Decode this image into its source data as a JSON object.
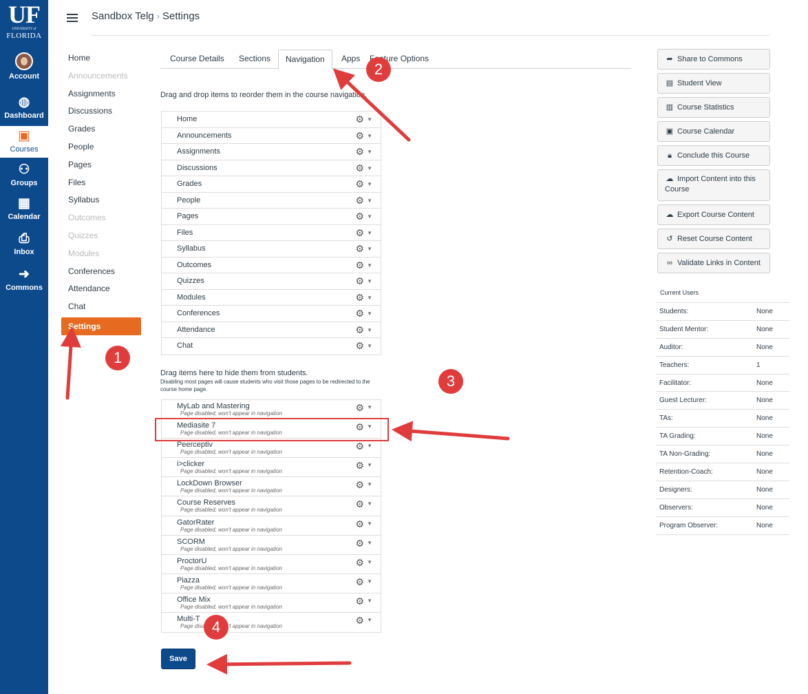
{
  "global_nav": {
    "logo": {
      "main": "UF",
      "university_of": "UNIVERSITY of",
      "florida": "FLORIDA"
    },
    "items": [
      {
        "label": "Account",
        "icon": "account-avatar"
      },
      {
        "label": "Dashboard",
        "icon": "dashboard-icon"
      },
      {
        "label": "Courses",
        "icon": "courses-icon"
      },
      {
        "label": "Groups",
        "icon": "groups-icon"
      },
      {
        "label": "Calendar",
        "icon": "calendar-icon"
      },
      {
        "label": "Inbox",
        "icon": "inbox-icon"
      },
      {
        "label": "Commons",
        "icon": "commons-icon"
      }
    ],
    "active": "Courses"
  },
  "breadcrumb": {
    "course": "Sandbox Telg",
    "page": "Settings"
  },
  "course_nav": [
    {
      "label": "Home",
      "state": "enabled"
    },
    {
      "label": "Announcements",
      "state": "disabled"
    },
    {
      "label": "Assignments",
      "state": "enabled"
    },
    {
      "label": "Discussions",
      "state": "enabled"
    },
    {
      "label": "Grades",
      "state": "enabled"
    },
    {
      "label": "People",
      "state": "enabled"
    },
    {
      "label": "Pages",
      "state": "enabled"
    },
    {
      "label": "Files",
      "state": "enabled"
    },
    {
      "label": "Syllabus",
      "state": "enabled"
    },
    {
      "label": "Outcomes",
      "state": "disabled"
    },
    {
      "label": "Quizzes",
      "state": "disabled"
    },
    {
      "label": "Modules",
      "state": "disabled"
    },
    {
      "label": "Conferences",
      "state": "enabled"
    },
    {
      "label": "Attendance",
      "state": "enabled"
    },
    {
      "label": "Chat",
      "state": "enabled"
    },
    {
      "label": "Settings",
      "state": "selected"
    }
  ],
  "tabs": [
    "Course Details",
    "Sections",
    "Navigation",
    "Apps",
    "Feature Options"
  ],
  "active_tab": "Navigation",
  "instructions": "Drag and drop items to reorder them in the course navigation.",
  "nav_items": [
    "Home",
    "Announcements",
    "Assignments",
    "Discussions",
    "Grades",
    "People",
    "Pages",
    "Files",
    "Syllabus",
    "Outcomes",
    "Quizzes",
    "Modules",
    "Conferences",
    "Attendance",
    "Chat"
  ],
  "hidden_heading": "Drag items here to hide them from students.",
  "hidden_note": "Disabling most pages will cause students who visit those pages to be redirected to the course home page.",
  "disabled_text": "Page disabled, won't appear in navigation",
  "hidden_items": [
    "MyLab and Mastering",
    "Mediasite 7",
    "Peerceptiv",
    "i>clicker",
    "LockDown Browser",
    "Course Reserves",
    "GatorRater",
    "SCORM",
    "ProctorU",
    "Piazza",
    "Office Mix",
    "Multi-T"
  ],
  "highlighted_item": "Mediasite 7",
  "save_label": "Save",
  "sidebar_buttons": [
    {
      "label": "Share to Commons",
      "icon": "share-icon"
    },
    {
      "label": "Student View",
      "icon": "student-view-icon"
    },
    {
      "label": "Course Statistics",
      "icon": "statistics-icon"
    },
    {
      "label": "Course Calendar",
      "icon": "calendar-icon"
    },
    {
      "label": "Conclude this Course",
      "icon": "lock-icon"
    },
    {
      "label": "Import Content into this Course",
      "icon": "import-icon"
    },
    {
      "label": "Export Course Content",
      "icon": "export-icon"
    },
    {
      "label": "Reset Course Content",
      "icon": "reset-icon"
    },
    {
      "label": "Validate Links in Content",
      "icon": "link-icon"
    }
  ],
  "current_users": {
    "heading": "Current Users",
    "rows": [
      {
        "role": "Students:",
        "count": "None"
      },
      {
        "role": "Student Mentor:",
        "count": "None"
      },
      {
        "role": "Auditor:",
        "count": "None"
      },
      {
        "role": "Teachers:",
        "count": "1"
      },
      {
        "role": "Facilitator:",
        "count": "None"
      },
      {
        "role": "Guest Lecturer:",
        "count": "None"
      },
      {
        "role": "TAs:",
        "count": "None"
      },
      {
        "role": "TA Grading:",
        "count": "None"
      },
      {
        "role": "TA Non-Grading:",
        "count": "None"
      },
      {
        "role": "Retention-Coach:",
        "count": "None"
      },
      {
        "role": "Designers:",
        "count": "None"
      },
      {
        "role": "Observers:",
        "count": "None"
      },
      {
        "role": "Program Observer:",
        "count": "None"
      }
    ]
  },
  "callouts": [
    "1",
    "2",
    "3",
    "4"
  ],
  "colors": {
    "global_nav": "#0d4a8c",
    "selected": "#e66b21",
    "callout": "#e03c3c",
    "save_button": "#0d4a8c"
  }
}
